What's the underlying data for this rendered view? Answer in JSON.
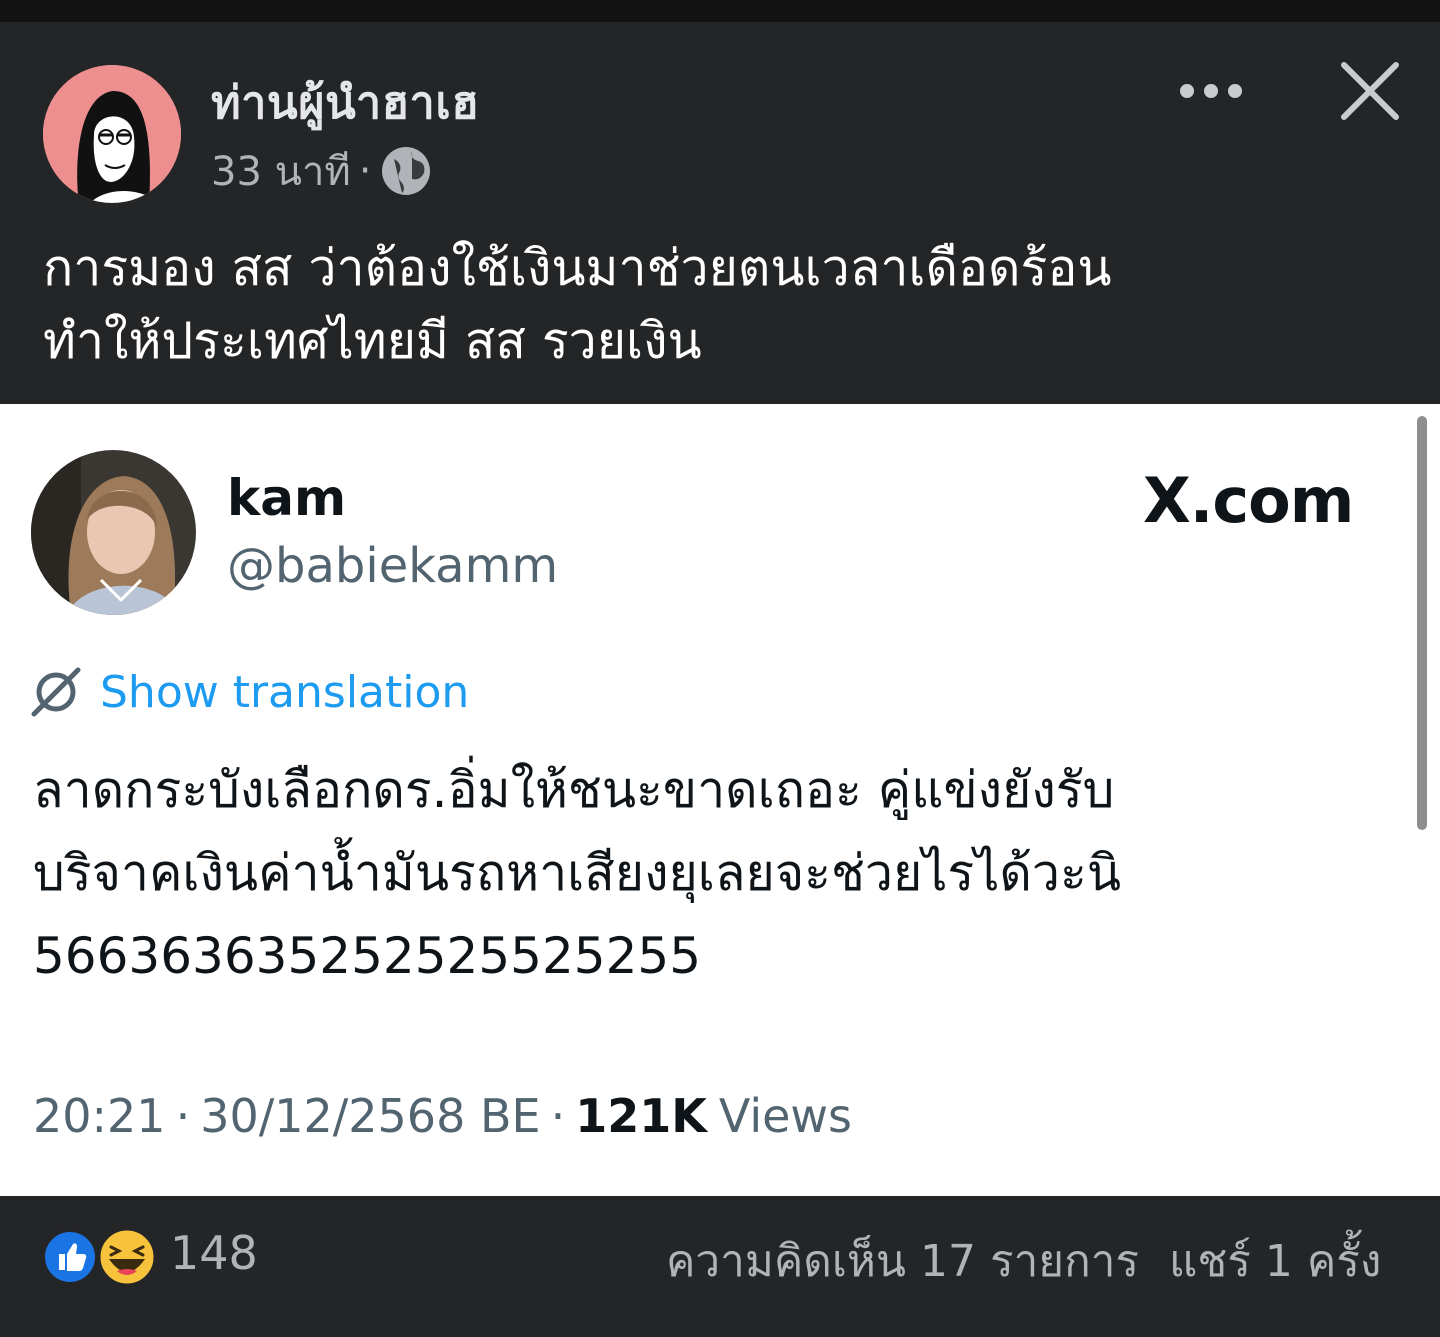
{
  "post": {
    "author_name": "ท่านผู้นำฮาเฮ",
    "time": "33 นาที",
    "separator": "·",
    "caption_lines": [
      "การมอง สส ว่าต้องใช้เงินมาช่วยตนเวลาเดือดร้อน",
      "ทำให้ประเทศไทยมี สส รวยเงิน"
    ]
  },
  "icons": {
    "globe": "globe-icon",
    "more": "more-options-icon",
    "close": "close-icon",
    "translate": "translate-icon",
    "like": "like-reaction-icon",
    "haha": "haha-reaction-icon"
  },
  "tweet": {
    "display_name": "kam",
    "handle": "@babiekamm",
    "site_logo": "X.com",
    "translation_link": "Show translation",
    "body_lines": [
      "ลาดกระบังเลือกดร.อิ่มให้ชนะขาดเถอะ คู่แข่งยังรับ",
      "บริจาคเงินค่าน้ำมันรถหาเสียงยุเลยจะช่วยไรได้วะนิ",
      "566363635252525525255"
    ],
    "time": "20:21",
    "date": "30/12/2568 BE",
    "separator": "·",
    "views_count": "121K",
    "views_label": "Views"
  },
  "footer": {
    "reaction_count": "148",
    "comments": "ความคิดเห็น 17 รายการ",
    "shares": "แชร์ 1 ครั้ง"
  },
  "colors": {
    "background": "#242526",
    "card": "#ffffff",
    "link": "#1d9bf0",
    "like_blue": "#1b74e4",
    "avatar_pink": "#ee8f8f"
  }
}
